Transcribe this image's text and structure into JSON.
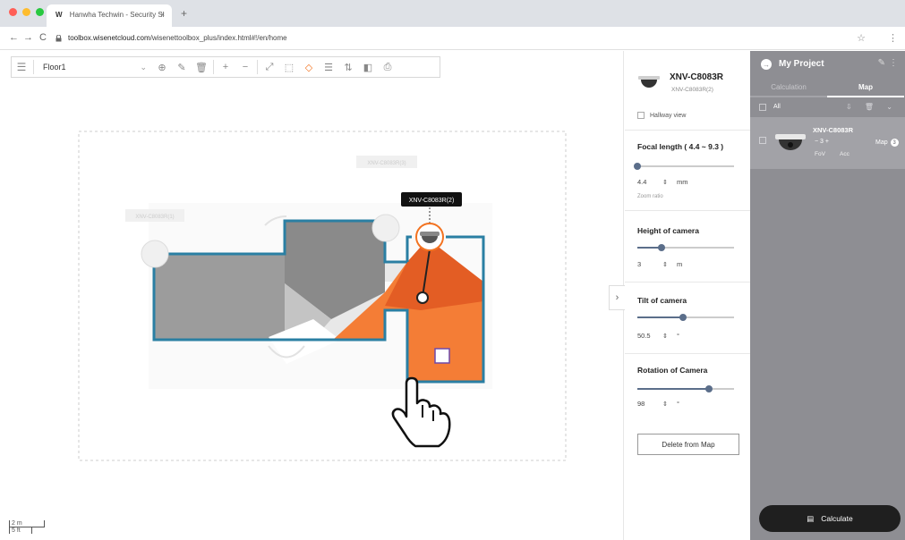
{
  "browser": {
    "tab_logo": "W",
    "tab_title": "Hanwha Techwin - Security Sl",
    "tab_close": "×",
    "new_tab": "+",
    "url_host": "toolbox.wisenetcloud.com",
    "url_path": "/wisenettoolbox_plus/index.html#!/en/home",
    "back": "←",
    "forward": "→",
    "reload": "C",
    "lock": "🔒",
    "bookmark": "☆",
    "menu": "⋮"
  },
  "toolbar": {
    "list_icon": "☰",
    "floor_name": "Floor1",
    "floor_caret": "⌄",
    "buttons": [
      "⊕",
      "✎",
      "🗑",
      "+",
      "−",
      "⤢",
      "⬚",
      "◇",
      "☰",
      "⇅",
      "◧",
      "⎙"
    ]
  },
  "canvas": {
    "tooltip": "XNV-C8083R(2)",
    "ghost_label_1": "XNV-C8083R(1)",
    "ghost_label_2": "XNV-C8083R(3)",
    "scale_m": "2 m",
    "scale_ft": "5 ft",
    "expand_icon": "›"
  },
  "properties": {
    "model": "XNV-C8083R",
    "instance": "XNV-C8083R(2)",
    "hallway_label": "Hallway view",
    "focal_title": "Focal length ( 4.4 ~ 9.3 )",
    "focal_value": "4.4",
    "focal_unit": "mm",
    "focal_fraction": 0.0,
    "zoom_note": "Zoom ratio",
    "height_title": "Height of camera",
    "height_value": "3",
    "height_unit": "m",
    "height_fraction": 0.25,
    "tilt_title": "Tilt of camera",
    "tilt_value": "50.5",
    "tilt_unit": "°",
    "tilt_fraction": 0.47,
    "rotation_title": "Rotation of Camera",
    "rotation_value": "98",
    "rotation_unit": "°",
    "rotation_fraction": 0.74,
    "spin_icon": "⇕",
    "delete_label": "Delete from Map"
  },
  "project": {
    "title": "My Project",
    "icon": "→",
    "edit_icon": "✎",
    "more_icon": "⋮",
    "tabs": [
      "Calculation",
      "Map"
    ],
    "active_tab": "Map",
    "all_label": "All",
    "all_icons": "⇩ 🗑 ⌄",
    "item_model": "XNV-C8083R",
    "item_qty": "−  3  +",
    "item_fov": "FoV",
    "item_acc": "Acc",
    "item_map_label": "Map",
    "item_map_count": "3",
    "calculate_label": "Calculate",
    "calculate_icon": "▤"
  },
  "colors": {
    "accent": "#f37321",
    "wall": "#2a7fa3",
    "panel_gray": "#8e8e93"
  }
}
